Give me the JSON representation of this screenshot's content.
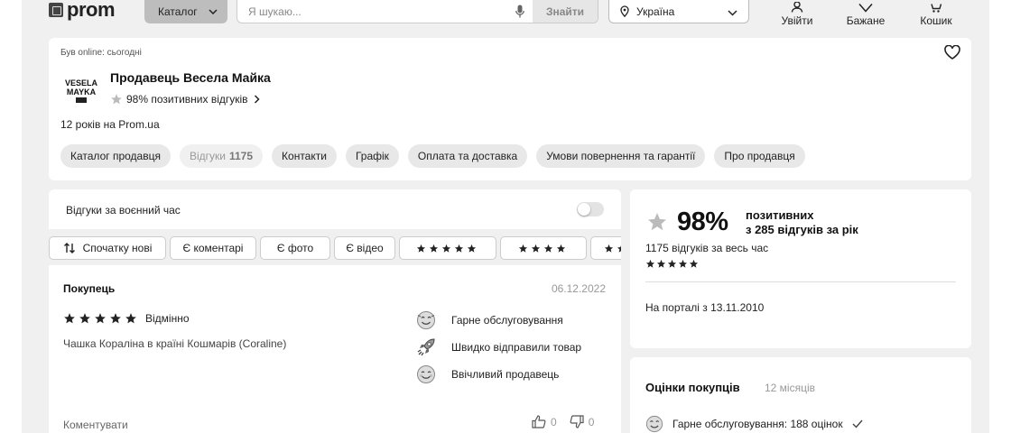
{
  "header": {
    "logo_text": "prom",
    "catalog_label": "Каталог",
    "search_placeholder": "Я шукаю...",
    "search_button": "Знайти",
    "region": "Україна",
    "login_label": "Увійти",
    "wishlist_label": "Бажане",
    "cart_label": "Кошик"
  },
  "seller": {
    "online_status": "Був online: сьогодні",
    "name": "Продавець Весела Майка",
    "rating_text": "98% позитивних відгуків",
    "years": "12 років на Prom.ua",
    "avatar_text": "VESELA MAYKA",
    "tabs": [
      {
        "label": "Каталог продавця"
      },
      {
        "label": "Відгуки",
        "count": "1175"
      },
      {
        "label": "Контакти"
      },
      {
        "label": "Графік"
      },
      {
        "label": "Оплата та доставка"
      },
      {
        "label": "Умови повернення та гарантії"
      },
      {
        "label": "Про продавця"
      }
    ]
  },
  "reviews": {
    "wartime_label": "Відгуки за воєнний час",
    "filters": {
      "sort": "Спочатку нові",
      "comments": "Є коментарі",
      "photo": "Є фото",
      "video": "Є відео"
    },
    "item": {
      "author": "Покупець",
      "date": "06.12.2022",
      "rating_label": "Відмінно",
      "product": "Чашка Кораліна в країні Кошмарів (Coraline)",
      "tags": [
        "Гарне обслуговування",
        "Швидко відправили товар",
        "Ввічливий продавець"
      ],
      "comment_label": "Коментувати",
      "likes": "0",
      "dislikes": "0"
    }
  },
  "summary": {
    "percent": "98%",
    "positive_label": "позитивних",
    "year_count": "з 285 відгуків за рік",
    "total": "1175 відгуків за весь час",
    "since": "На порталі з 13.11.2010"
  },
  "buyer_ratings": {
    "title": "Оцінки покупців",
    "period": "12 місяців",
    "first_item": "Гарне обслуговування: 188 оцінок"
  },
  "colors": {
    "background": "#f0f0f0",
    "card": "#ffffff",
    "catalog_button": "#bdbdbd",
    "chip": "#e8e8e8",
    "muted_text": "#999999"
  }
}
